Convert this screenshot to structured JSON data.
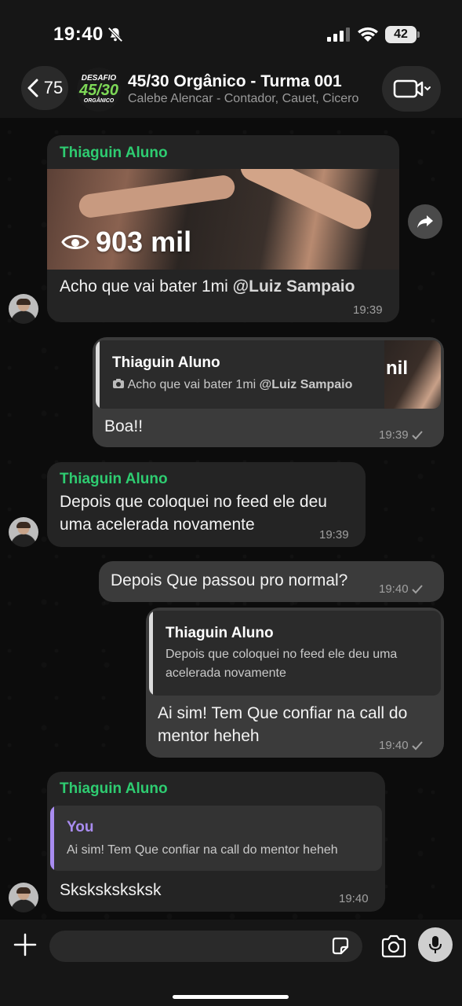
{
  "status_bar": {
    "time": "19:40",
    "battery": "42"
  },
  "header": {
    "back_count": "75",
    "group_logo": {
      "top": "DESAFIO",
      "mid": "45/30",
      "bot": "ORGÂNICO"
    },
    "title": "45/30 Orgânico - Turma 001",
    "subtitle": "Calebe Alencar - Contador, Cauet, Cicero"
  },
  "messages": [
    {
      "sender": "Thiaguin Aluno",
      "video_views": "903 mil",
      "text": "Acho que vai bater 1mi",
      "mention": "@Luiz Sampaio",
      "time": "19:39"
    },
    {
      "quote_name": "Thiaguin Aluno",
      "quote_text": "Acho que vai bater 1mi",
      "quote_mention": "@Luiz Sampaio",
      "quote_thumb_text": "nil",
      "text": "Boa!!",
      "time": "19:39"
    },
    {
      "sender": "Thiaguin Aluno",
      "text": "Depois que coloquei no feed ele deu uma acelerada novamente",
      "time": "19:39"
    },
    {
      "text": "Depois Que passou pro normal?",
      "time": "19:40"
    },
    {
      "quote_name": "Thiaguin Aluno",
      "quote_text": "Depois que coloquei no feed ele deu uma acelerada novamente",
      "text": "Ai sim! Tem Que confiar na call do mentor heheh",
      "time": "19:40"
    },
    {
      "sender": "Thiaguin Aluno",
      "quote_name": "You",
      "quote_text": "Ai sim! Tem Que confiar na call do mentor heheh",
      "text": "Sksksksksksk",
      "time": "19:40"
    }
  ],
  "composer": {
    "placeholder": ""
  },
  "colors": {
    "sender": "#2ecc71",
    "you_quote": "#a98cf0",
    "bubble_in": "#242424",
    "bubble_out": "#3b3b3b"
  }
}
